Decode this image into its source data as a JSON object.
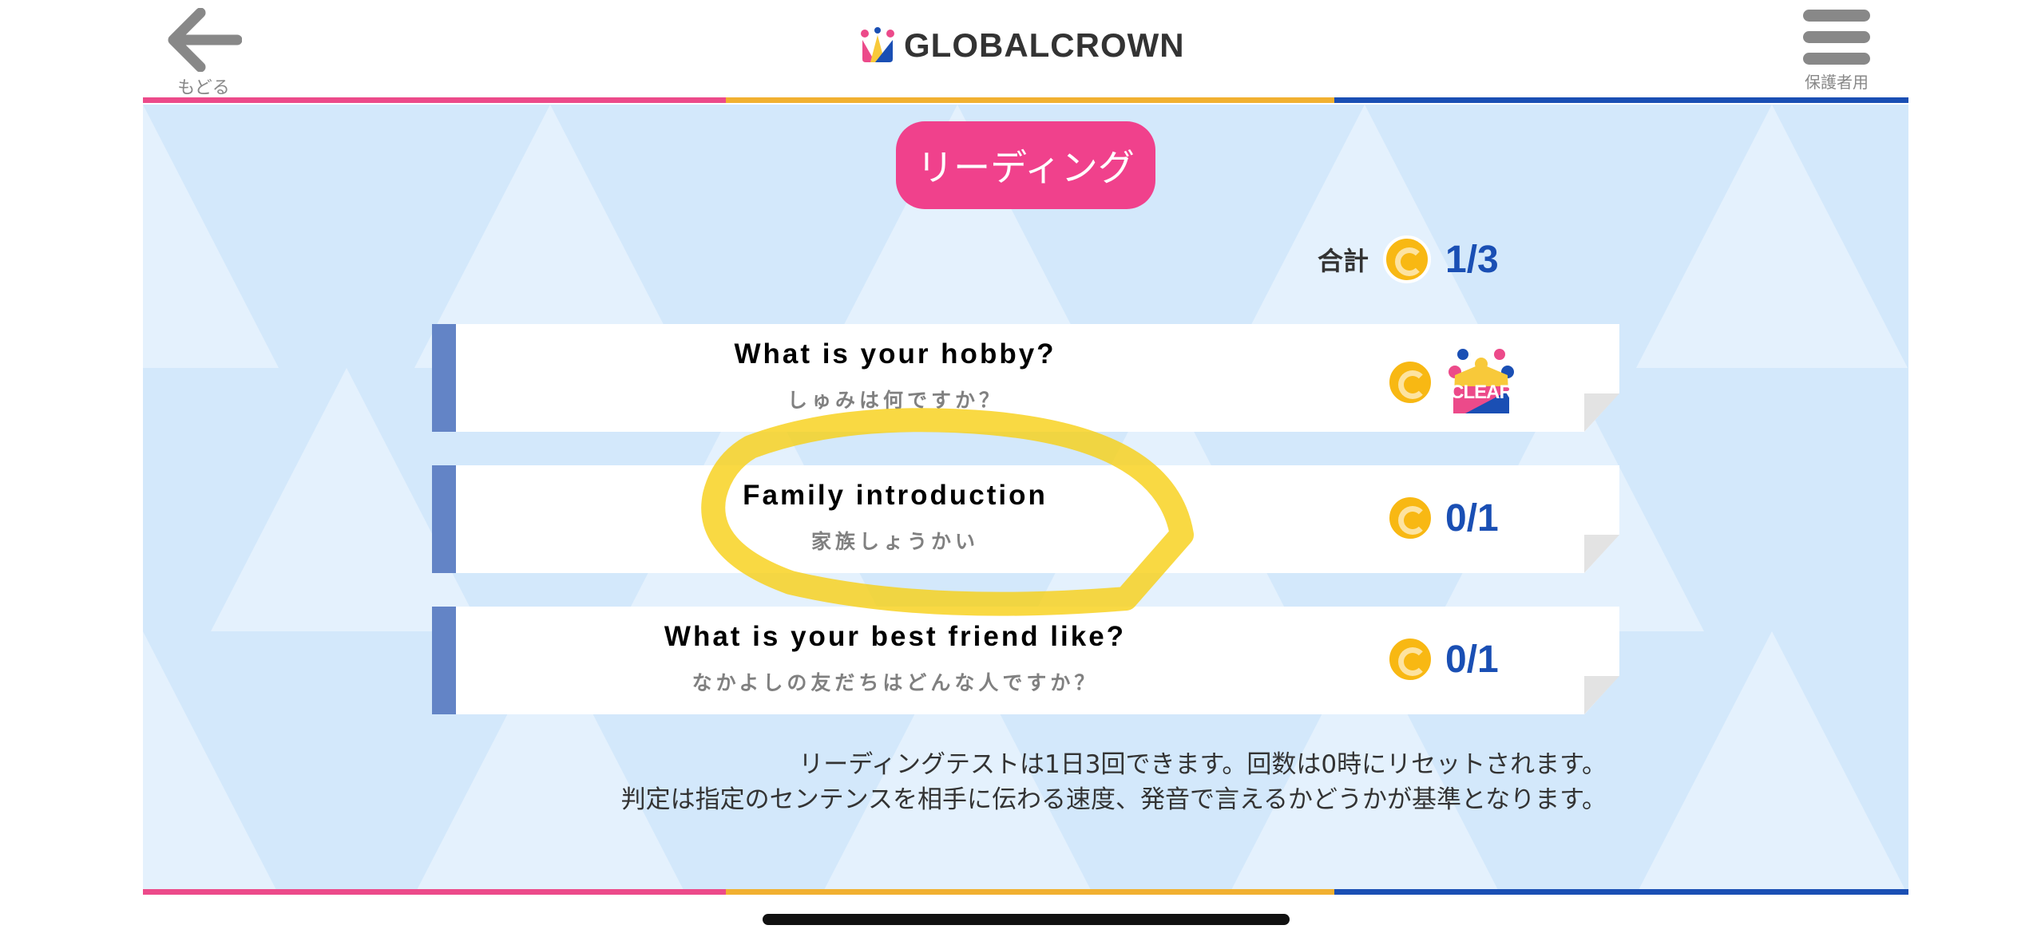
{
  "header": {
    "back_label": "もどる",
    "logo_text": "GLOBALCROWN",
    "menu_label": "保護者用"
  },
  "colors": {
    "pink": "#ec4a8a",
    "yellow": "#f1b030",
    "blue": "#1a4fb4",
    "coin": "#f8b813",
    "highlight": "#f7cf14"
  },
  "title": "リーディング",
  "total": {
    "label": "合計",
    "value": "1/3",
    "icon": "coin-icon"
  },
  "items": [
    {
      "en": "What is your hobby?",
      "ja": "しゅみは何ですか？",
      "status": "CLEAR",
      "score": null
    },
    {
      "en": "Family introduction",
      "ja": "家族しょうかい",
      "score": "0/1"
    },
    {
      "en": "What is your best friend like?",
      "ja": "なかよしの友だちはどんな人ですか？",
      "score": "0/1"
    }
  ],
  "notes": [
    "リーディングテストは1日3回できます。回数は0時にリセットされます。",
    "判定は指定のセンテンスを相手に伝わる速度、発音で言えるかどうかが基準となります。"
  ]
}
